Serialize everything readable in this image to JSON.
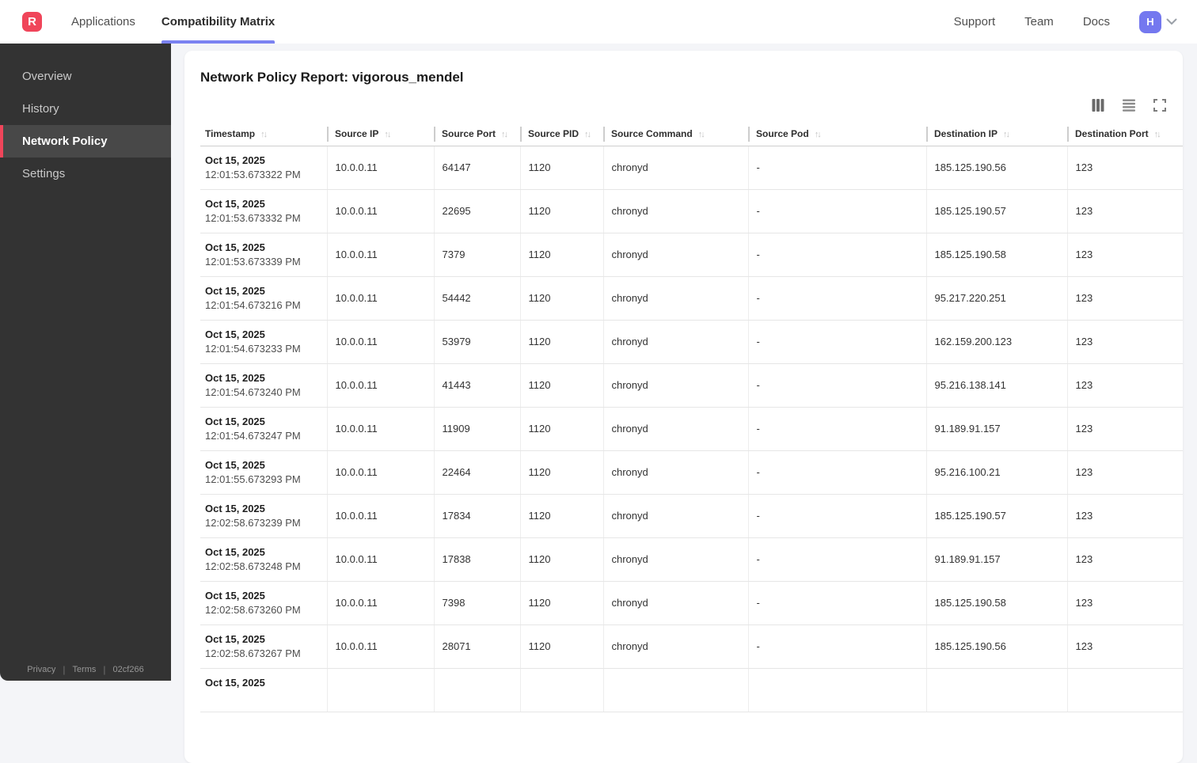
{
  "colors": {
    "accent_red": "#f0455a",
    "accent_indigo": "#7b82f1",
    "avatar_bg": "#7478ef",
    "sidebar_bg": "#333333",
    "sidebar_active_bg": "#484848",
    "page_bg": "#f4f5f8"
  },
  "topbar": {
    "logo_letter": "R",
    "tabs": [
      {
        "label": "Applications",
        "active": false
      },
      {
        "label": "Compatibility Matrix",
        "active": true
      }
    ],
    "links": [
      {
        "label": "Support"
      },
      {
        "label": "Team"
      },
      {
        "label": "Docs"
      }
    ],
    "avatar_initial": "H",
    "chevron_icon": "chevron-down"
  },
  "sidebar": {
    "items": [
      {
        "label": "Overview",
        "active": false
      },
      {
        "label": "History",
        "active": false
      },
      {
        "label": "Network Policy",
        "active": true
      },
      {
        "label": "Settings",
        "active": false
      }
    ],
    "footer": {
      "privacy_label": "Privacy",
      "terms_label": "Terms",
      "build_id": "02cf266",
      "separator": "|"
    }
  },
  "report": {
    "title": "Network Policy Report: vigorous_mendel",
    "toolbar_icons": [
      "columns-icon",
      "rows-icon",
      "fullscreen-icon"
    ]
  },
  "table": {
    "sort_glyph": "↑↓",
    "columns": [
      "Timestamp",
      "Source IP",
      "Source Port",
      "Source PID",
      "Source Command",
      "Source Pod",
      "Destination IP",
      "Destination Port"
    ],
    "rows": [
      {
        "date": "Oct 15, 2025",
        "time": "12:01:53.673322 PM",
        "source_ip": "10.0.0.11",
        "source_port": "64147",
        "source_pid": "1120",
        "source_command": "chronyd",
        "source_pod": "-",
        "destination_ip": "185.125.190.56",
        "destination_port": "123"
      },
      {
        "date": "Oct 15, 2025",
        "time": "12:01:53.673332 PM",
        "source_ip": "10.0.0.11",
        "source_port": "22695",
        "source_pid": "1120",
        "source_command": "chronyd",
        "source_pod": "-",
        "destination_ip": "185.125.190.57",
        "destination_port": "123"
      },
      {
        "date": "Oct 15, 2025",
        "time": "12:01:53.673339 PM",
        "source_ip": "10.0.0.11",
        "source_port": "7379",
        "source_pid": "1120",
        "source_command": "chronyd",
        "source_pod": "-",
        "destination_ip": "185.125.190.58",
        "destination_port": "123"
      },
      {
        "date": "Oct 15, 2025",
        "time": "12:01:54.673216 PM",
        "source_ip": "10.0.0.11",
        "source_port": "54442",
        "source_pid": "1120",
        "source_command": "chronyd",
        "source_pod": "-",
        "destination_ip": "95.217.220.251",
        "destination_port": "123"
      },
      {
        "date": "Oct 15, 2025",
        "time": "12:01:54.673233 PM",
        "source_ip": "10.0.0.11",
        "source_port": "53979",
        "source_pid": "1120",
        "source_command": "chronyd",
        "source_pod": "-",
        "destination_ip": "162.159.200.123",
        "destination_port": "123"
      },
      {
        "date": "Oct 15, 2025",
        "time": "12:01:54.673240 PM",
        "source_ip": "10.0.0.11",
        "source_port": "41443",
        "source_pid": "1120",
        "source_command": "chronyd",
        "source_pod": "-",
        "destination_ip": "95.216.138.141",
        "destination_port": "123"
      },
      {
        "date": "Oct 15, 2025",
        "time": "12:01:54.673247 PM",
        "source_ip": "10.0.0.11",
        "source_port": "11909",
        "source_pid": "1120",
        "source_command": "chronyd",
        "source_pod": "-",
        "destination_ip": "91.189.91.157",
        "destination_port": "123"
      },
      {
        "date": "Oct 15, 2025",
        "time": "12:01:55.673293 PM",
        "source_ip": "10.0.0.11",
        "source_port": "22464",
        "source_pid": "1120",
        "source_command": "chronyd",
        "source_pod": "-",
        "destination_ip": "95.216.100.21",
        "destination_port": "123"
      },
      {
        "date": "Oct 15, 2025",
        "time": "12:02:58.673239 PM",
        "source_ip": "10.0.0.11",
        "source_port": "17834",
        "source_pid": "1120",
        "source_command": "chronyd",
        "source_pod": "-",
        "destination_ip": "185.125.190.57",
        "destination_port": "123"
      },
      {
        "date": "Oct 15, 2025",
        "time": "12:02:58.673248 PM",
        "source_ip": "10.0.0.11",
        "source_port": "17838",
        "source_pid": "1120",
        "source_command": "chronyd",
        "source_pod": "-",
        "destination_ip": "91.189.91.157",
        "destination_port": "123"
      },
      {
        "date": "Oct 15, 2025",
        "time": "12:02:58.673260 PM",
        "source_ip": "10.0.0.11",
        "source_port": "7398",
        "source_pid": "1120",
        "source_command": "chronyd",
        "source_pod": "-",
        "destination_ip": "185.125.190.58",
        "destination_port": "123"
      },
      {
        "date": "Oct 15, 2025",
        "time": "12:02:58.673267 PM",
        "source_ip": "10.0.0.11",
        "source_port": "28071",
        "source_pid": "1120",
        "source_command": "chronyd",
        "source_pod": "-",
        "destination_ip": "185.125.190.56",
        "destination_port": "123"
      },
      {
        "date": "Oct 15, 2025",
        "time": "",
        "source_ip": "",
        "source_port": "",
        "source_pid": "",
        "source_command": "",
        "source_pod": "",
        "destination_ip": "",
        "destination_port": ""
      }
    ]
  }
}
